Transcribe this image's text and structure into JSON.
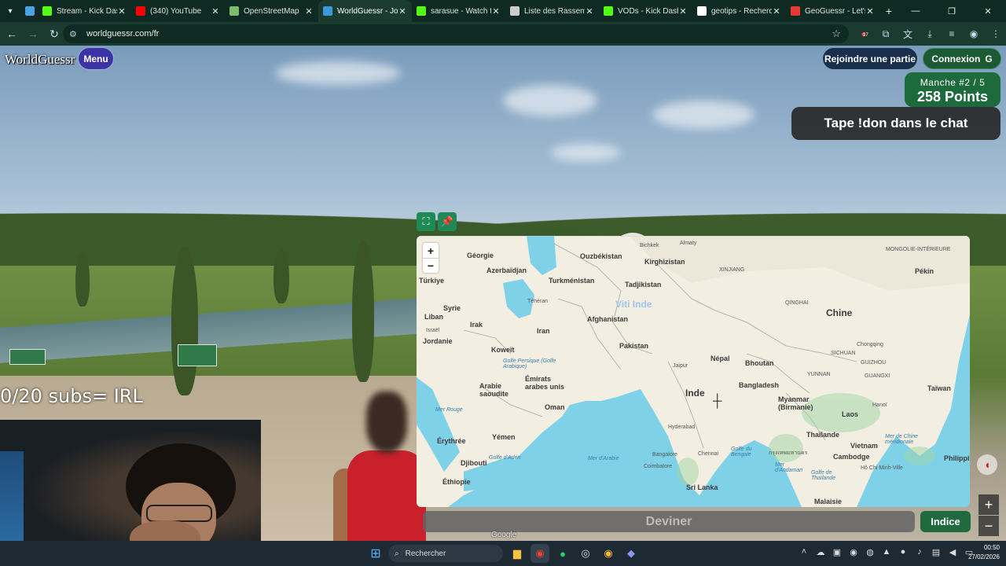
{
  "browser": {
    "tabs": [
      {
        "title": "",
        "favicon": "app-icon",
        "color": "#4aa3df"
      },
      {
        "title": "Stream - Kick Dashb",
        "favicon": "kick-icon",
        "color": "#53fc18"
      },
      {
        "title": "(340) YouTube",
        "favicon": "youtube-icon",
        "color": "#ff0000"
      },
      {
        "title": "OpenStreetMap",
        "favicon": "osm-icon",
        "color": "#7ebc6f"
      },
      {
        "title": "WorldGuessr - Jouer",
        "favicon": "globe-icon",
        "color": "#3a9ad9",
        "active": true
      },
      {
        "title": "sarasue - Watch the",
        "favicon": "kick-icon",
        "color": "#53fc18"
      },
      {
        "title": "Liste des Rassemble",
        "favicon": "list-icon",
        "color": "#cccccc"
      },
      {
        "title": "VODs - Kick Dashbo",
        "favicon": "kick-icon",
        "color": "#53fc18"
      },
      {
        "title": "geotips - Recherche",
        "favicon": "google-icon",
        "color": "#ffffff"
      },
      {
        "title": "GeoGuessr - Let's ex",
        "favicon": "pin-icon",
        "color": "#e53935"
      }
    ],
    "url": "worldguessr.com/fr",
    "extension_badge": "17"
  },
  "game": {
    "logo": "WorldGuessr",
    "menu_label": "Menu",
    "join_label": "Rejoindre une partie",
    "login_label": "Connexion",
    "round_label": "Manche #2 / 5",
    "points_label": "258 Points",
    "chat_banner": "Tape !don dans le chat",
    "guess_label": "Deviner",
    "hint_label": "Indice",
    "google_tag": "Google"
  },
  "stream_overlay": {
    "subs_text": "0/20 subs= IRL"
  },
  "map": {
    "watermark": "Viti Inde",
    "labels": {
      "georgie": "Géorgie",
      "ouzbekistan": "Ouzbékistan",
      "bichkek": "Bichkek",
      "almaty": "Almaty",
      "kirghizistan": "Kirghizistan",
      "mongolie": "MONGOLIE-INTÉRIEURE",
      "azerbaidjan": "Azerbaïdjan",
      "turkiye": "Türkiye",
      "turkmenistan": "Turkménistan",
      "tadjikistan": "Tadjikistan",
      "xinjiang": "XINJIANG",
      "pekin": "Pékin",
      "teheran": "Téhéran",
      "syrie": "Syrie",
      "qinghai": "QINGHAI",
      "liban": "Liban",
      "irak": "Irak",
      "afghanistan": "Afghanistan",
      "chine": "Chine",
      "israel": "Israël",
      "jordanie": "Jordanie",
      "iran": "Iran",
      "pakistan": "Pakistan",
      "koweit": "Koweït",
      "chongqing": "Chongqing",
      "nepal": "Népal",
      "bhoutan": "Bhoutan",
      "golfe_persique": "Golfe Persique (Golfe Arabique)",
      "jaipur": "Jaipur",
      "emirats": "Émirats arabes unis",
      "arabie": "Arabie saoudite",
      "bangladesh": "Bangladesh",
      "taiwan": "Taïwan",
      "inde": "Inde",
      "oman": "Oman",
      "myanmar": "Myanmar (Birmanie)",
      "hanoi": "Hanoï",
      "laos": "Laos",
      "mer_rouge": "Mer Rouge",
      "hyderabad": "Hyderabad",
      "thailande": "Thaïlande",
      "yemen": "Yémen",
      "erythree": "Érythrée",
      "vietnam": "Vietnam",
      "mer_chine": "Mer de Chine méridionale",
      "golfe_aden": "Golfe d'Aden",
      "djibouti": "Djibouti",
      "mer_arabie": "Mer d'Arabie",
      "bangalore": "Bangalore",
      "chennai": "Chennai",
      "golfe_bengale": "Golfe du Bengale",
      "bangkok": "กรุงเทพมหานคร",
      "cambodge": "Cambodge",
      "philippines": "Philippines",
      "ethiopie": "Éthiopie",
      "mer_andaman": "Mer d'Andaman",
      "golfe_thailande": "Golfe de Thaïlande",
      "coimbatore": "Coimbatore",
      "hcm": "Hô Chi Minh-Ville",
      "sri_lanka": "Sri Lanka",
      "malaisie": "Malaisie",
      "guizhou": "GUIZHOU",
      "guangxi": "GUANGXI",
      "yunnan": "YUNNAN",
      "sichuan": "SICHUAN"
    }
  },
  "taskbar": {
    "search_placeholder": "Rechercher",
    "time": "00:50",
    "date": "27/02/2026"
  }
}
